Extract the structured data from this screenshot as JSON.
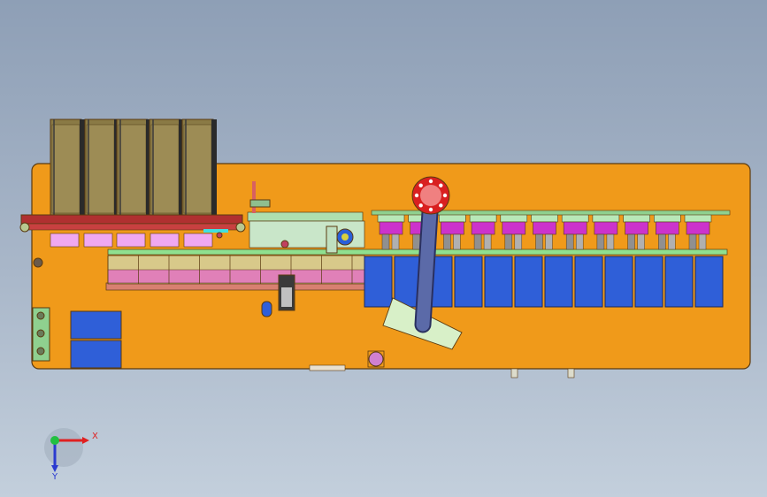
{
  "viewport": {
    "background_top": "#8e9fb6",
    "background_bottom": "#c3cfdc"
  },
  "model": {
    "base_plate_color": "#f09a1a",
    "outline_color": "#5a3a10",
    "magazine_color": "#8a7a45",
    "rail_color": "#8fe08f",
    "tray_color": "#2f5fd8",
    "pink_block_color": "#e080e0",
    "magenta_block_color": "#cc33cc",
    "flange_color": "#d92020",
    "arm_color": "#5b6aa8",
    "pad_color": "#d8f0c8",
    "station_count": 11,
    "tray_count": 12,
    "magazine_count": 5
  },
  "triad": {
    "x_label": "X",
    "y_label": "Y",
    "x_color": "#e02020",
    "y_color": "#2a3ad0",
    "origin_color": "#22c040"
  }
}
